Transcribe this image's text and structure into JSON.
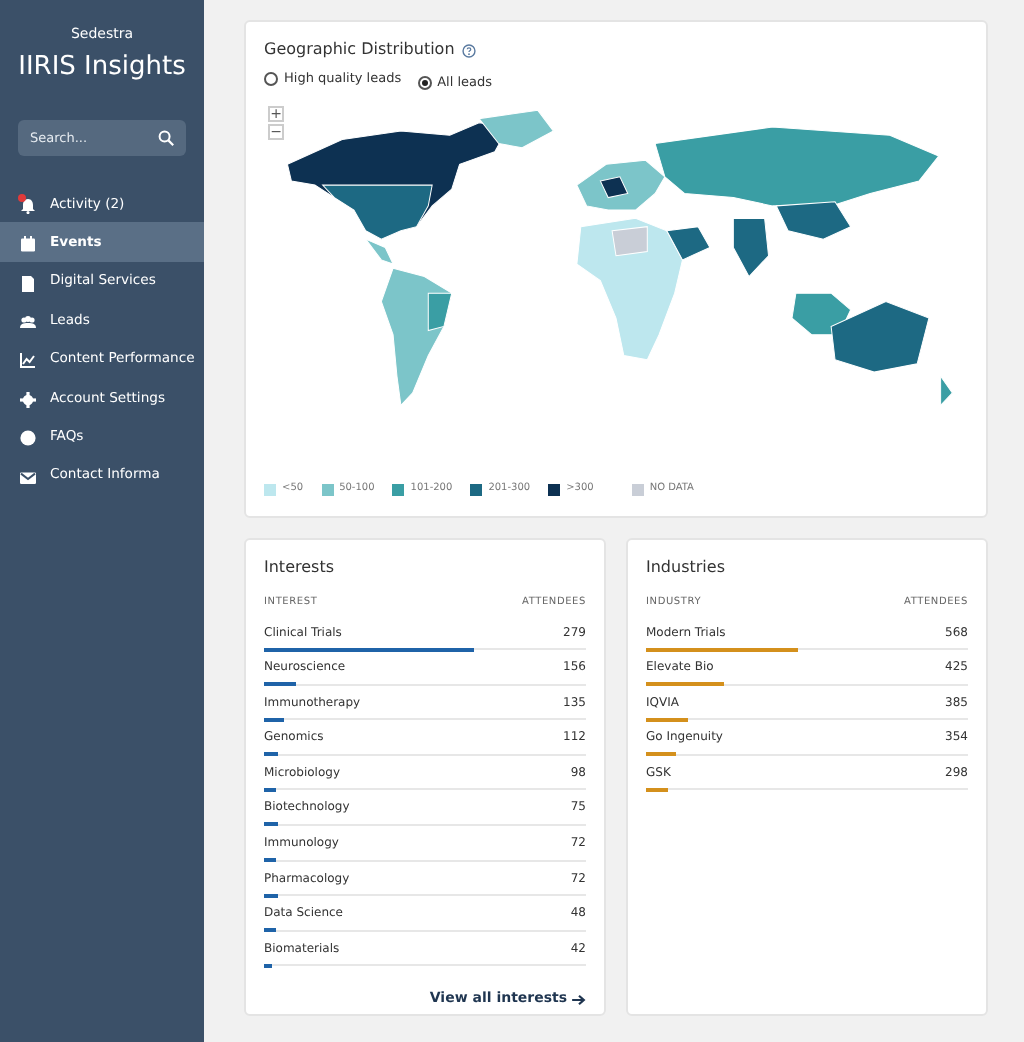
{
  "sidebar": {
    "org": "Sedestra",
    "title": "IIRIS Insights",
    "search": {
      "placeholder": "Search..."
    },
    "items": [
      {
        "label": "Activity (2)",
        "selected": false,
        "alert": true
      },
      {
        "label": "Events",
        "selected": true,
        "alert": false
      },
      {
        "label": "Digital Services",
        "selected": false,
        "alert": false
      },
      {
        "label": "Leads",
        "selected": false,
        "alert": false
      },
      {
        "label": "Content Performance",
        "selected": false,
        "alert": false
      },
      {
        "label": "Account Settings",
        "selected": false,
        "alert": false
      },
      {
        "label": "FAQs",
        "selected": false,
        "alert": false
      },
      {
        "label": "Contact Informa",
        "selected": false,
        "alert": false
      }
    ]
  },
  "geo": {
    "title": "Geographic Distribution",
    "options": [
      {
        "label": "High quality leads",
        "selected": false
      },
      {
        "label": "All leads",
        "selected": true
      }
    ],
    "zoom": [
      "+",
      "−"
    ],
    "legend": [
      {
        "label": "<50",
        "color": "#bde7ee"
      },
      {
        "label": "50-100",
        "color": "#7cc5c9"
      },
      {
        "label": "101-200",
        "color": "#3a9ea4"
      },
      {
        "label": "201-300",
        "color": "#1d6983"
      },
      {
        "label": ">300",
        "color": "#0d3152"
      },
      {
        "label": "NO DATA",
        "color": "#c9ced7"
      }
    ]
  },
  "interests": {
    "title": "Interests",
    "columns": [
      "INTEREST",
      "ATTENDEES"
    ],
    "rows": [
      {
        "name": "Clinical Trials",
        "value": "279",
        "level": 0.65
      },
      {
        "name": "Neuroscience",
        "value": "156",
        "level": 0.1
      },
      {
        "name": "Immunotherapy",
        "value": "135",
        "level": 0.06
      },
      {
        "name": "Genomics",
        "value": "112",
        "level": 0.045
      },
      {
        "name": "Microbiology",
        "value": "98",
        "level": 0.04
      },
      {
        "name": "Biotechnology",
        "value": "75",
        "level": 0.045
      },
      {
        "name": "Immunology",
        "value": "72",
        "level": 0.04
      },
      {
        "name": "Pharmacology",
        "value": "72",
        "level": 0.045
      },
      {
        "name": "Data Science",
        "value": "48",
        "level": 0.035
      },
      {
        "name": "Biomaterials",
        "value": "42",
        "level": 0.025
      }
    ],
    "link": "View all interests"
  },
  "industries": {
    "title": "Industries",
    "columns": [
      "INDUSTRY",
      "ATTENDEES"
    ],
    "rows": [
      {
        "name": "Modern Trials",
        "value": "568",
        "level": 0.47
      },
      {
        "name": "Elevate Bio",
        "value": "425",
        "level": 0.24
      },
      {
        "name": "IQVIA",
        "value": "385",
        "level": 0.13
      },
      {
        "name": "Go Ingenuity",
        "value": "354",
        "level": 0.095
      },
      {
        "name": "GSK",
        "value": "298",
        "level": 0.07
      }
    ]
  }
}
